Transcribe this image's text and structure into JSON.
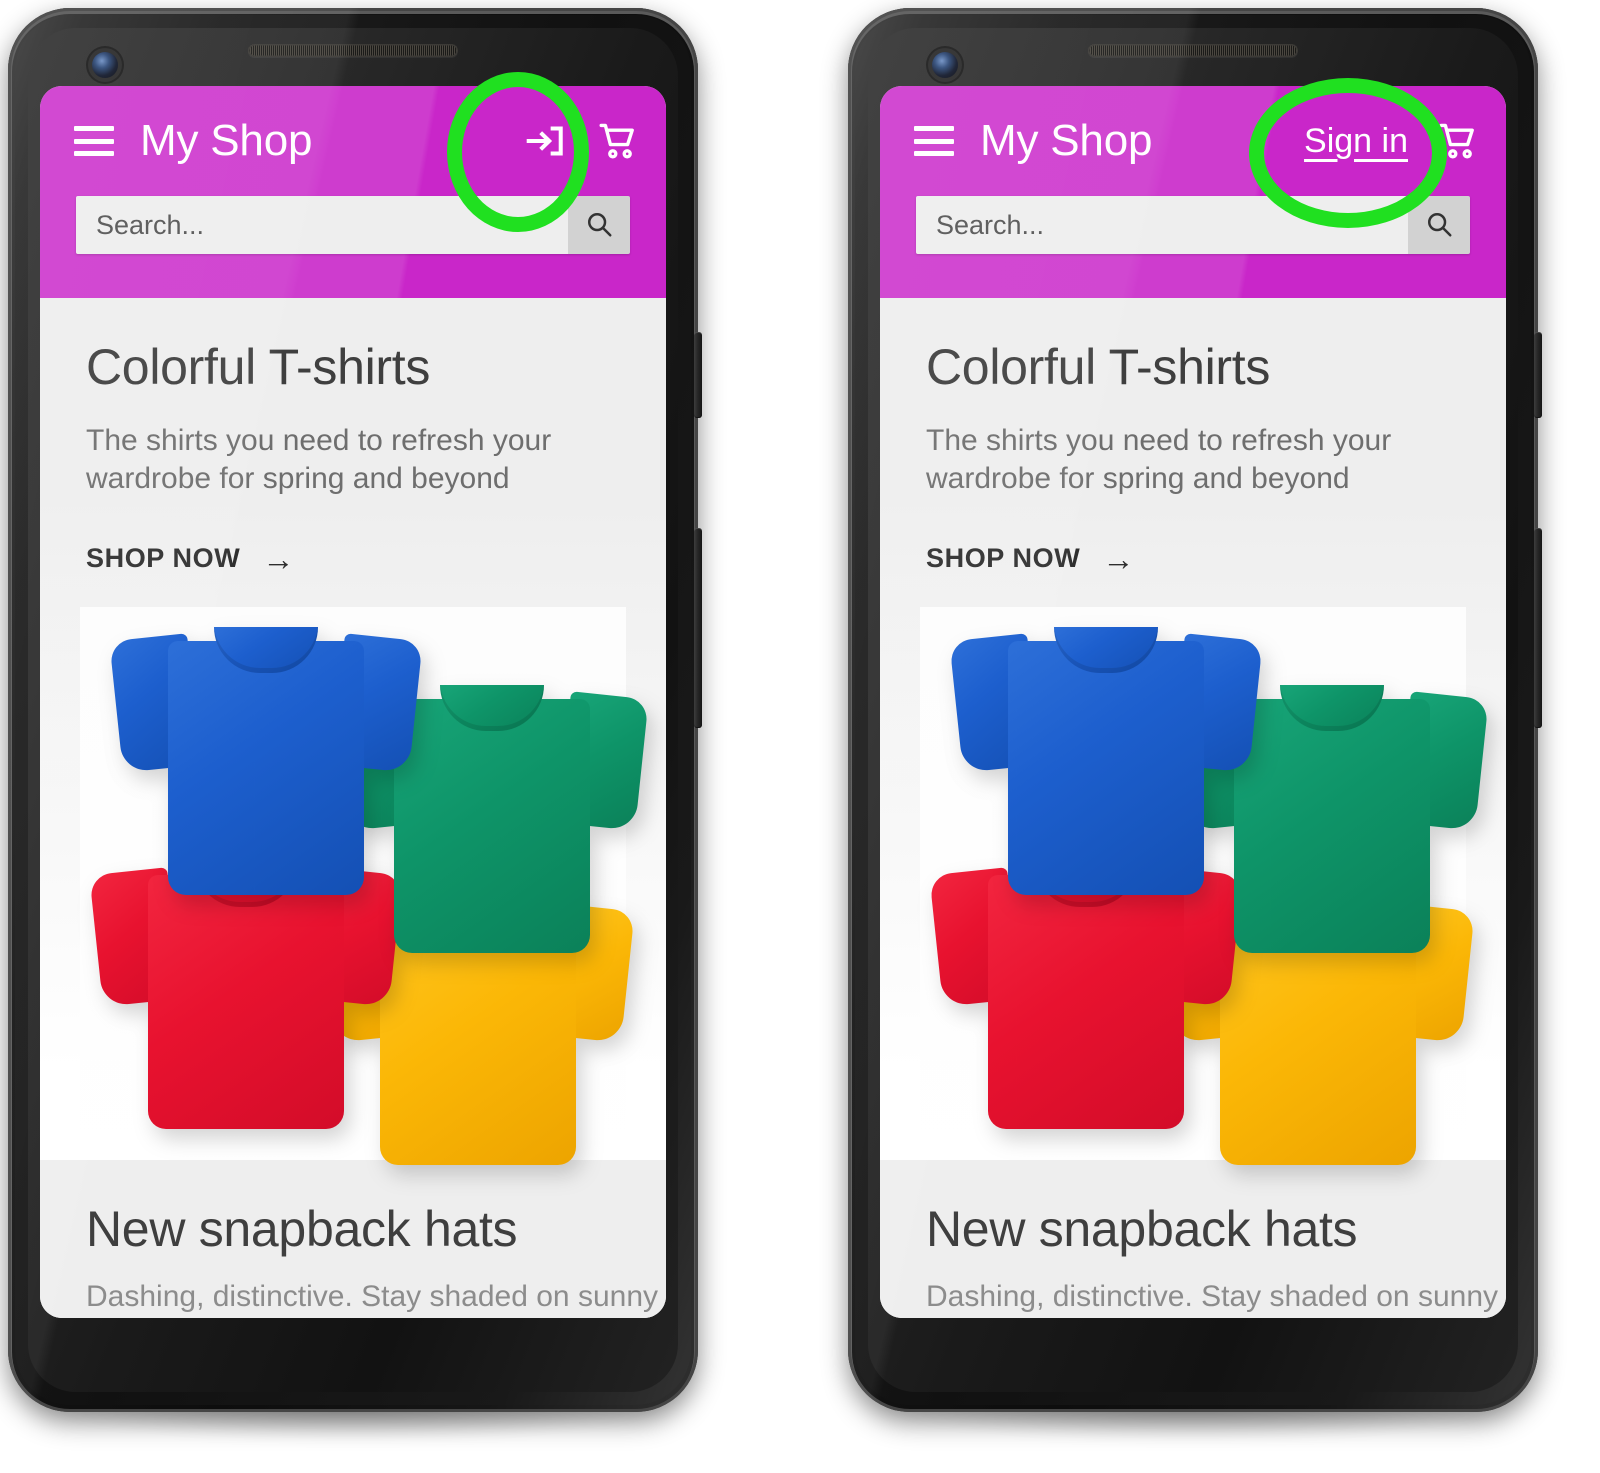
{
  "app": {
    "brand": "My Shop",
    "theme_color": "#c926c9",
    "highlight_color": "#20e020"
  },
  "search": {
    "placeholder": "Search...",
    "value": "",
    "button_icon": "search-icon"
  },
  "header_actions": {
    "menu_icon": "hamburger-menu-icon",
    "cart_icon": "shopping-cart-icon",
    "login_icon": "login-arrow-icon",
    "signin_label": "Sign in"
  },
  "hero": {
    "title": "Colorful T-shirts",
    "subtitle": "The shirts you need to refresh your wardrobe for spring and beyond",
    "cta_label": "SHOP NOW",
    "cta_arrow": "→",
    "image_alt": "four-tshirts-photo",
    "shirt_colors": [
      "#1d5fce",
      "#0e9468",
      "#e8122f",
      "#fbb706"
    ]
  },
  "next_section": {
    "title": "New snapback hats",
    "subtitle": "Dashing, distinctive. Stay shaded on sunny"
  },
  "phones": [
    {
      "id": "phone-left",
      "variant": "login-icon",
      "highlighted_element": "login-arrow-icon"
    },
    {
      "id": "phone-right",
      "variant": "sign-in-text",
      "highlighted_element": "sign-in-link"
    }
  ]
}
